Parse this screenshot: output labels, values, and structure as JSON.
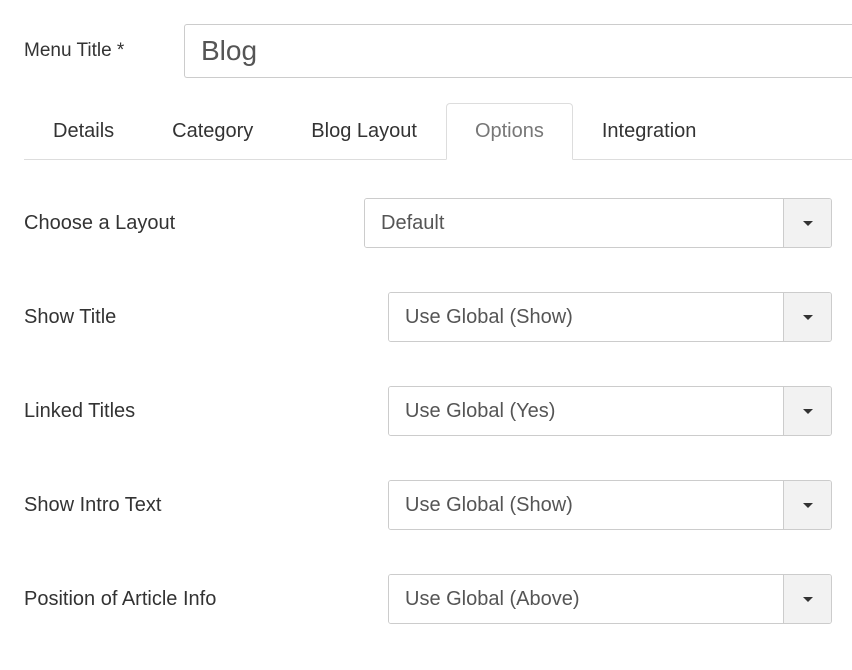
{
  "header": {
    "title_label": "Menu Title *",
    "title_value": "Blog"
  },
  "tabs": {
    "details": "Details",
    "category": "Category",
    "blog_layout": "Blog Layout",
    "options": "Options",
    "integration": "Integration"
  },
  "fields": {
    "choose_layout": {
      "label": "Choose a Layout",
      "value": "Default"
    },
    "show_title": {
      "label": "Show Title",
      "value": "Use Global (Show)"
    },
    "linked_titles": {
      "label": "Linked Titles",
      "value": "Use Global (Yes)"
    },
    "show_intro_text": {
      "label": "Show Intro Text",
      "value": "Use Global (Show)"
    },
    "position_article_info": {
      "label": "Position of Article Info",
      "value": "Use Global (Above)"
    }
  }
}
